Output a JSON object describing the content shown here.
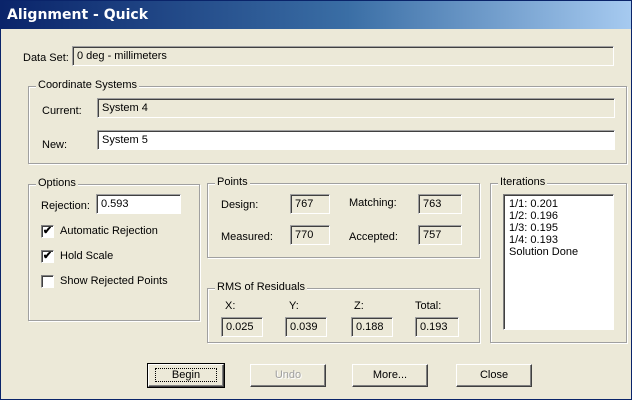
{
  "window": {
    "title": "Alignment - Quick"
  },
  "data_set": {
    "label": "Data Set:",
    "value": "0 deg - millimeters"
  },
  "coordinate_systems": {
    "title": "Coordinate Systems",
    "current_label": "Current:",
    "current_value": "System 4",
    "new_label": "New:",
    "new_value": "System 5"
  },
  "options": {
    "title": "Options",
    "rejection_label": "Rejection:",
    "rejection_value": "0.593",
    "auto_rejection_label": "Automatic Rejection",
    "auto_rejection_checked": true,
    "hold_scale_label": "Hold Scale",
    "hold_scale_checked": true,
    "show_rejected_label": "Show Rejected Points",
    "show_rejected_checked": false
  },
  "points": {
    "title": "Points",
    "design_label": "Design:",
    "design_value": "767",
    "matching_label": "Matching:",
    "matching_value": "763",
    "measured_label": "Measured:",
    "measured_value": "770",
    "accepted_label": "Accepted:",
    "accepted_value": "757"
  },
  "rms": {
    "title": "RMS of Residuals",
    "x_label": "X:",
    "x_value": "0.025",
    "y_label": "Y:",
    "y_value": "0.039",
    "z_label": "Z:",
    "z_value": "0.188",
    "total_label": "Total:",
    "total_value": "0.193"
  },
  "iterations": {
    "title": "Iterations",
    "items": [
      "1/1: 0.201",
      "1/2: 0.196",
      "1/3: 0.195",
      "1/4: 0.193",
      "Solution Done"
    ]
  },
  "buttons": {
    "begin": "Begin",
    "undo": "Undo",
    "more": "More...",
    "close": "Close"
  },
  "colors": {
    "titlebar_start": "#0a246a",
    "titlebar_end": "#a6caf0",
    "dialog_bg": "#ece9d8"
  }
}
